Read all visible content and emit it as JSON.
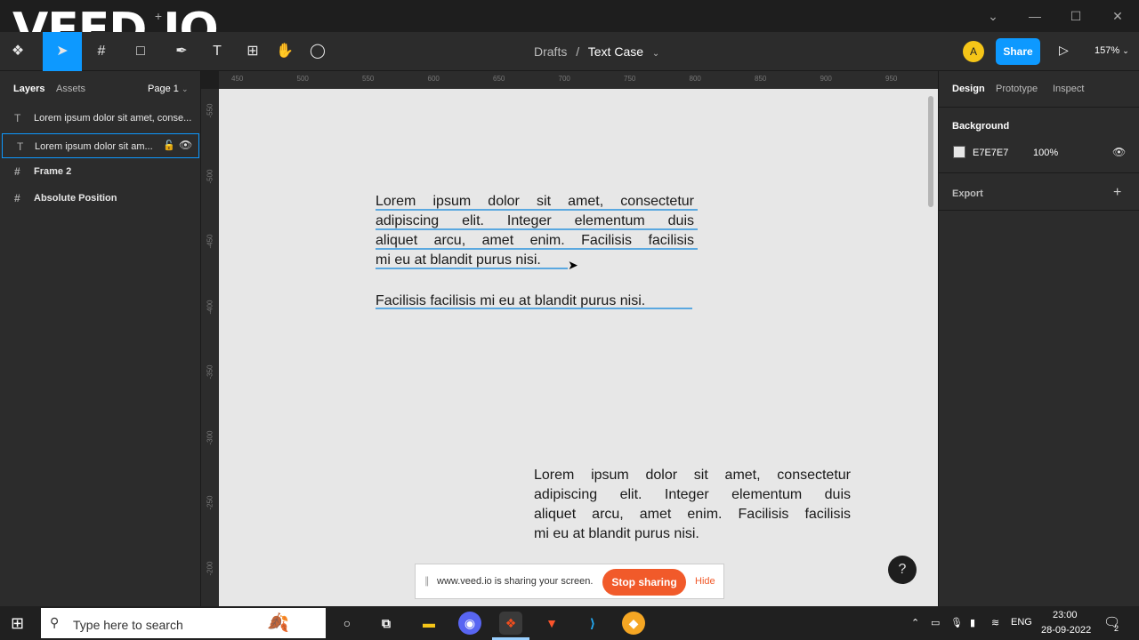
{
  "window": {
    "tab_title": "Text Case",
    "watermark": "VEED.IO"
  },
  "toolbar": {
    "breadcrumb_root": "Drafts",
    "breadcrumb_sep": "/",
    "file_name": "Text Case",
    "avatar_letter": "A",
    "share_label": "Share",
    "zoom": "157%"
  },
  "left_panel": {
    "tabs": [
      "Layers",
      "Assets"
    ],
    "page": "Page 1",
    "layers": [
      {
        "icon": "T",
        "label": "Lorem ipsum dolor sit amet, conse..."
      },
      {
        "icon": "T",
        "label": "Lorem ipsum dolor sit am..."
      },
      {
        "icon": "#",
        "label": "Frame 2"
      },
      {
        "icon": "#",
        "label": "Absolute Position"
      }
    ]
  },
  "right_panel": {
    "tabs": [
      "Design",
      "Prototype",
      "Inspect"
    ],
    "background_title": "Background",
    "bg_hex": "E7E7E7",
    "bg_opacity": "100%",
    "export_label": "Export",
    "colors": {
      "bg_swatch": "#e7e7e7"
    }
  },
  "ruler": {
    "top": [
      "450",
      "500",
      "550",
      "600",
      "650",
      "700",
      "750",
      "800",
      "850",
      "900",
      "950"
    ],
    "left": [
      "-550",
      "-500",
      "-450",
      "-400",
      "-350",
      "-300",
      "-250",
      "-200"
    ]
  },
  "canvas": {
    "text1_lines": [
      "Lorem ipsum dolor sit amet, consectetur",
      "adipiscing elit. Integer elementum duis",
      "aliquet arcu, amet enim. Facilisis facilisis",
      "mi eu at blandit purus nisi."
    ],
    "text2": "Facilisis facilisis mi eu at blandit purus nisi.",
    "text3_lines": [
      "Lorem ipsum dolor sit amet, consectetur",
      "adipiscing elit. Integer elementum duis",
      "aliquet arcu, amet enim. Facilisis facilisis",
      "mi eu at blandit purus nisi."
    ]
  },
  "share_bar": {
    "message": "www.veed.io is sharing your screen.",
    "stop_label": "Stop sharing",
    "hide_label": "Hide"
  },
  "help_label": "?",
  "taskbar": {
    "search_placeholder": "Type here to search",
    "lang": "ENG",
    "time": "23:00",
    "date": "28-09-2022",
    "notif_count": "2"
  }
}
